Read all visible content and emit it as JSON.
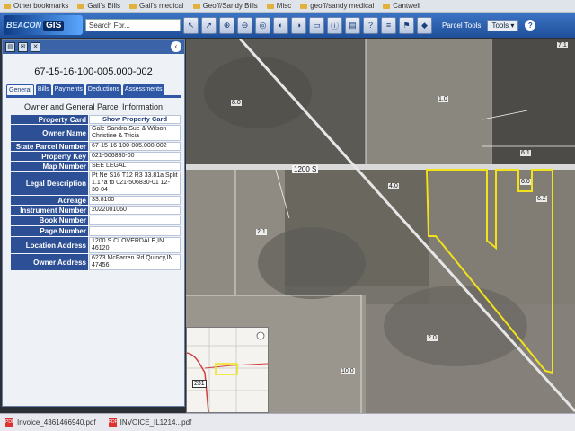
{
  "bookmarks": [
    {
      "label": "Other bookmarks"
    },
    {
      "label": "Gail's Bills"
    },
    {
      "label": "Gail's medical"
    },
    {
      "label": "Geoff/Sandy Bills"
    },
    {
      "label": "Misc"
    },
    {
      "label": "geoff/sandy medical"
    },
    {
      "label": "Cantwell"
    }
  ],
  "toolbar": {
    "logo_text1": "BEACON",
    "logo_text2": "GIS",
    "search_placeholder": "Search For...",
    "parcel_tools_label": "Parcel Tools",
    "tools_dropdown": "Tools ▾",
    "help": "?"
  },
  "panel": {
    "parcel_id": "67-15-16-100-005.000-002",
    "tabs": [
      "General",
      "Bills",
      "Payments",
      "Deductions",
      "Assessments"
    ],
    "section_title": "Owner and General Parcel Information",
    "fields": {
      "property_card_label": "Property Card",
      "property_card_value": "Show Property Card",
      "owner_name_label": "Owner Name",
      "owner_name_value": "Gale Sandra Sue & Wilson Christine & Tricia",
      "state_parcel_label": "State Parcel Number",
      "state_parcel_value": "67-15-16-100-005.000-002",
      "property_key_label": "Property Key",
      "property_key_value": "021-506830-00",
      "map_number_label": "Map Number",
      "map_number_value": "SEE LEGAL",
      "legal_desc_label": "Legal Description",
      "legal_desc_value": "Pt Ne S16 T12 R3 33.81a Split 1.17a to 021-506830-01 12-30-04",
      "acreage_label": "Acreage",
      "acreage_value": "33.8100",
      "instrument_label": "Instrument Number",
      "instrument_value": "2022001060",
      "book_label": "Book Number",
      "book_value": "",
      "page_label": "Page Number",
      "page_value": "",
      "location_label": "Location Address",
      "location_value": "1200 S CLOVERDALE,IN 46120",
      "owner_addr_label": "Owner Address",
      "owner_addr_value": "6273 McFarren Rd Quincy,IN 47456"
    }
  },
  "map": {
    "road_label": "1200 S",
    "parcel_labels": [
      "8.0",
      "1.0",
      "7.1",
      "6.1",
      "4.0",
      "6.0",
      "6.2",
      "2.1",
      "2.0",
      "10.0"
    ],
    "inset_route": "231",
    "highlight_color": "#f2e21a"
  },
  "downloads": [
    {
      "name": "Invoice_4361466940.pdf"
    },
    {
      "name": "INVOICE_IL1214...pdf"
    }
  ]
}
